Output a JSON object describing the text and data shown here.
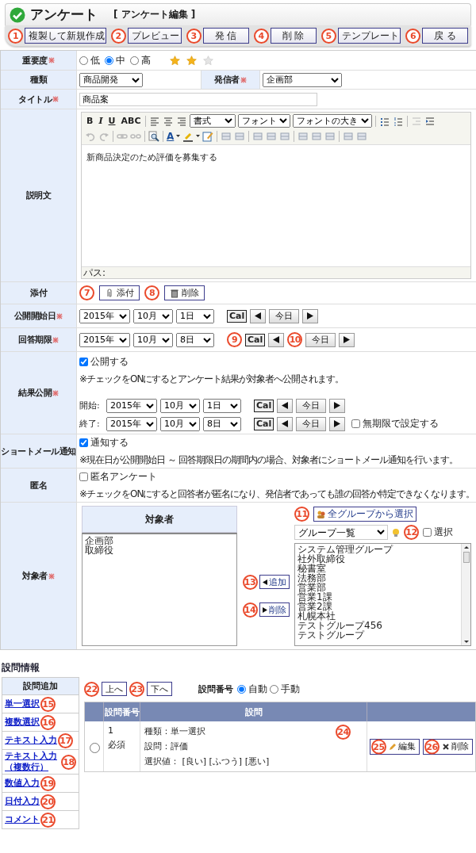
{
  "header": {
    "title": "アンケート",
    "subtitle": "[ アンケート編集 ]"
  },
  "toolbar": [
    {
      "label": "複製して新規作成",
      "callout": "1"
    },
    {
      "label": "プレビュー",
      "callout": "2"
    },
    {
      "label": "発 信",
      "callout": "3"
    },
    {
      "label": "削 除",
      "callout": "4"
    },
    {
      "label": "テンプレート",
      "callout": "5"
    },
    {
      "label": "戻 る",
      "callout": "6"
    }
  ],
  "form": {
    "importance": {
      "label": "重要度",
      "required": true,
      "options": [
        {
          "label": "低",
          "selected": false
        },
        {
          "label": "中",
          "selected": true
        },
        {
          "label": "高",
          "selected": false
        }
      ],
      "stars": 2
    },
    "type": {
      "label": "種類",
      "value": "商品開発"
    },
    "sender": {
      "label": "発信者",
      "required": true,
      "value": "企画部"
    },
    "title": {
      "label": "タイトル",
      "required": true,
      "value": "商品案"
    },
    "description": {
      "label": "説明文",
      "format_buttons": [
        "B",
        "I",
        "U",
        "ABC"
      ],
      "selects": [
        "書式",
        "フォント",
        "フォントの大き"
      ],
      "font_color_label": "A",
      "content": "新商品決定のため評価を募集する",
      "path_label": "パス:"
    },
    "attachment": {
      "label": "添付",
      "buttons": [
        {
          "label": "添付",
          "callout": "7"
        },
        {
          "label": "削除",
          "callout": "8"
        }
      ]
    },
    "publish_start": {
      "label": "公開開始日",
      "required": true,
      "year": "2015年",
      "month": "10月",
      "day": "1日",
      "cal": "Cal",
      "today": "今日"
    },
    "answer_deadline": {
      "label": "回答期限",
      "required": true,
      "year": "2015年",
      "month": "10月",
      "day": "8日",
      "cal": "Cal",
      "today": "今日",
      "cal_callout": "9",
      "today_callout": "10"
    },
    "result": {
      "label": "結果公開",
      "required": true,
      "checkbox": {
        "label": "公開する",
        "checked": true
      },
      "note": "※チェックをONにするとアンケート結果が対象者へ公開されます。",
      "start": {
        "prefix": "開始:",
        "year": "2015年",
        "month": "10月",
        "day": "1日",
        "cal": "Cal",
        "today": "今日"
      },
      "end": {
        "prefix": "終了:",
        "year": "2015年",
        "month": "10月",
        "day": "8日",
        "cal": "Cal",
        "today": "今日"
      },
      "unlimited": {
        "label": "無期限で設定する",
        "checked": false
      }
    },
    "short_mail": {
      "label": "ショートメール通知",
      "checkbox": {
        "label": "通知する",
        "checked": true
      },
      "note": "※現在日が公開開始日 ～ 回答期限日の期間内の場合、対象者にショートメール通知を行います。"
    },
    "anonymous": {
      "label": "匿名",
      "checkbox": {
        "label": "匿名アンケート",
        "checked": false
      },
      "note": "※チェックをONにすると回答者が匿名になり、発信者であっても誰の回答か特定できなくなります。"
    },
    "targets": {
      "label": "対象者",
      "required": true,
      "list_header": "対象者",
      "selected_items": [
        "企画部",
        "取締役"
      ],
      "all_groups_button": {
        "label": "全グループから選択",
        "callout": "11"
      },
      "group_select": "グループ一覧",
      "select_checkbox": {
        "label": "選択",
        "checked": false,
        "callout": "12"
      },
      "add_button": {
        "label": "追加",
        "callout": "13"
      },
      "remove_button": {
        "label": "削除",
        "callout": "14"
      },
      "groups": [
        "システム管理グループ",
        "社外取締役",
        "秘書室",
        "法務部",
        "営業部",
        "営業1課",
        "営業2課",
        "札幌本社",
        "テストグループ456",
        "テストグループ"
      ]
    }
  },
  "questions": {
    "heading": "設問情報",
    "add_panel": {
      "title": "設問追加",
      "links": [
        {
          "label": "単一選択",
          "callout": "15"
        },
        {
          "label": "複数選択",
          "callout": "16"
        },
        {
          "label": "テキスト入力",
          "callout": "17"
        },
        {
          "label": "テキスト入力（複数行）",
          "callout": "18"
        },
        {
          "label": "数値入力",
          "callout": "19"
        },
        {
          "label": "日付入力",
          "callout": "20"
        },
        {
          "label": "コメント",
          "callout": "21"
        }
      ]
    },
    "up_button": {
      "label": "上へ",
      "callout": "22"
    },
    "down_button": {
      "label": "下へ",
      "callout": "23"
    },
    "numbering": {
      "label": "設問番号",
      "options": [
        {
          "label": "自動",
          "selected": true
        },
        {
          "label": "手動",
          "selected": false
        }
      ]
    },
    "columns": [
      "設問番号",
      "設問"
    ],
    "rows": [
      {
        "selected": false,
        "number": "1",
        "required_label": "必須",
        "lines": [
          "種類：単一選択",
          "設問：評価",
          "選択値： [良い] [ふつう] [悪い]"
        ],
        "callout": "24",
        "edit_button": {
          "label": "編集",
          "callout": "25"
        },
        "delete_button": {
          "label": "削除",
          "callout": "26"
        }
      }
    ]
  }
}
